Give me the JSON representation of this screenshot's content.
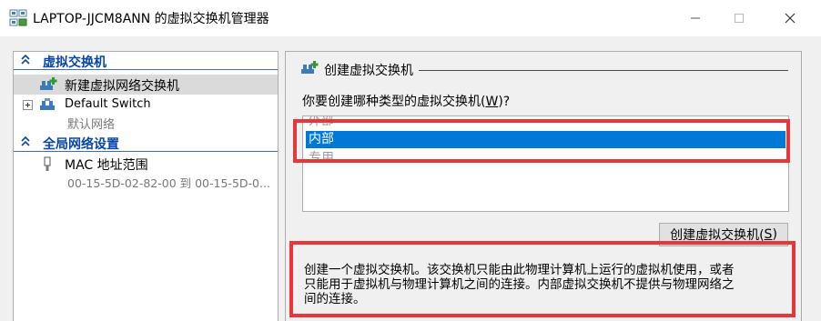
{
  "window": {
    "title": "LAPTOP-JJCM8ANN 的虚拟交换机管理器",
    "icon": "switch-manager-icon"
  },
  "sidebar": {
    "section_virtual_switches": "虚拟交换机",
    "new_switch_label": "新建虚拟网络交换机",
    "default_switch_label": "Default Switch",
    "default_switch_sub": "默认网络",
    "section_global": "全局网络设置",
    "mac_range_label": "MAC 地址范围",
    "mac_range_value": "00-15-5D-02-82-00 到 00-15-5D-0..."
  },
  "panel": {
    "title": "创建虚拟交换机",
    "question_prefix": "你要创建哪种类型的虚拟交换机(",
    "question_key": "W",
    "question_suffix": ")?",
    "types": [
      "外部",
      "内部",
      "专用"
    ],
    "selected_type": "内部",
    "create_button_prefix": "创建虚拟交换机(",
    "create_button_key": "S",
    "create_button_suffix": ")",
    "description_lines": [
      "创建一个虚拟交换机。该交换机只能由此物理计算机上运行的虚拟机使用，或者",
      "只能用于虚拟机与物理计算机之间的连接。内部虚拟交换机不提供与物理网络之",
      "间的连接。"
    ]
  },
  "colors": {
    "selection": "#0078d7",
    "section_header": "#0645ad",
    "highlight": "#e8373a"
  }
}
